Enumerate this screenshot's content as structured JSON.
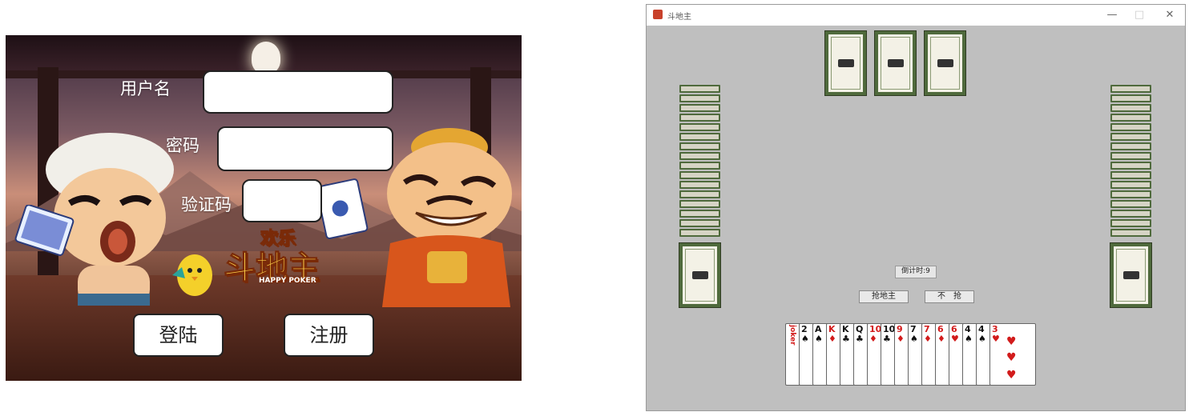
{
  "login": {
    "username_label": "用户名",
    "password_label": "密码",
    "captcha_label": "验证码",
    "username_value": "",
    "password_value": "",
    "captcha_value": "",
    "login_button": "登陆",
    "register_button": "注册",
    "logo_main": "欢乐",
    "logo_sub": "斗地主",
    "logo_en": "HAPPY POKER"
  },
  "game": {
    "window_title": "斗地主",
    "controls": {
      "minimize": "—",
      "maximize": "□",
      "close": "✕"
    },
    "timer_text": "倒计时:9",
    "grab_landlord_button": "抢地主",
    "pass_button": "不　抢",
    "hand": [
      {
        "rank": "joker",
        "suit": "",
        "color": "red"
      },
      {
        "rank": "2",
        "suit": "♠",
        "color": "black"
      },
      {
        "rank": "A",
        "suit": "♠",
        "color": "black"
      },
      {
        "rank": "K",
        "suit": "♦",
        "color": "red"
      },
      {
        "rank": "K",
        "suit": "♣",
        "color": "black"
      },
      {
        "rank": "Q",
        "suit": "♣",
        "color": "black"
      },
      {
        "rank": "10",
        "suit": "♦",
        "color": "red"
      },
      {
        "rank": "10",
        "suit": "♣",
        "color": "black"
      },
      {
        "rank": "9",
        "suit": "♦",
        "color": "red"
      },
      {
        "rank": "7",
        "suit": "♠",
        "color": "black"
      },
      {
        "rank": "7",
        "suit": "♦",
        "color": "red"
      },
      {
        "rank": "6",
        "suit": "♦",
        "color": "red"
      },
      {
        "rank": "6",
        "suit": "♥",
        "color": "red"
      },
      {
        "rank": "4",
        "suit": "♠",
        "color": "black"
      },
      {
        "rank": "4",
        "suit": "♠",
        "color": "black"
      },
      {
        "rank": "3",
        "suit": "♥",
        "color": "red"
      }
    ],
    "colors": {
      "table": "#bfbfbf",
      "card_border": "#4f6a3c"
    }
  }
}
